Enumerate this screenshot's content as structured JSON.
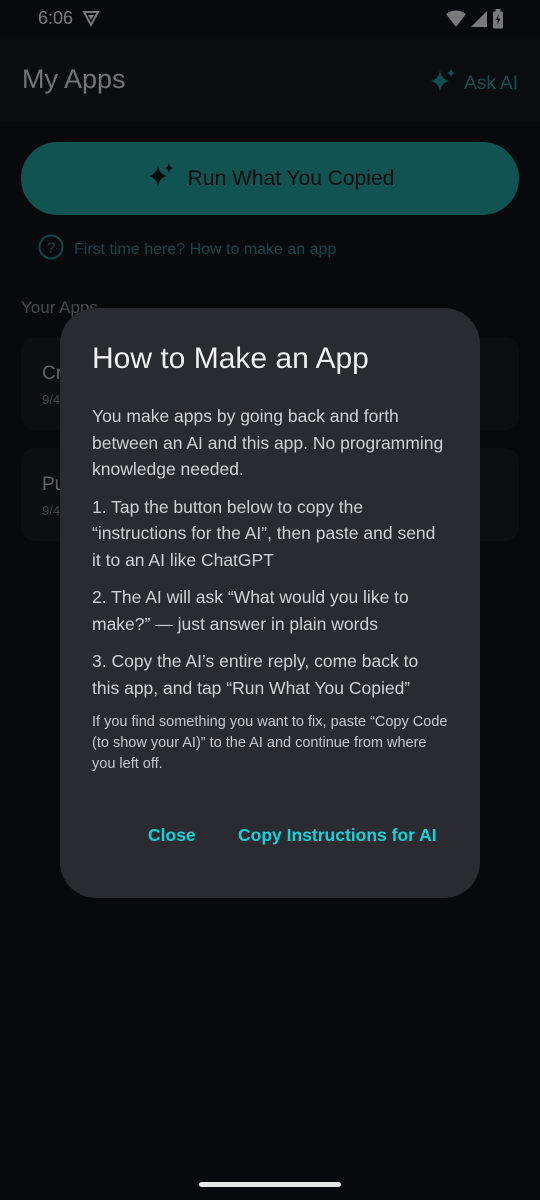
{
  "status_bar": {
    "time": "6:06",
    "icons": [
      "vpn-shield-icon",
      "wifi-icon",
      "cellular-signal-icon",
      "battery-icon"
    ]
  },
  "app_bar": {
    "title": "My Apps",
    "ask_ai_label": "Ask AI",
    "ask_ai_icon": "sparkle-icon"
  },
  "main": {
    "run_button_label": "Run What You Copied",
    "help_link_label": "First time here? How to make an app",
    "section_label": "Your Apps",
    "apps": [
      {
        "title": "Cr",
        "date": "9/4"
      },
      {
        "title": "Pu",
        "date": "9/4"
      }
    ]
  },
  "dialog": {
    "title": "How to Make an App",
    "intro": "You make apps by going back and forth between an AI and this app. No programming knowledge needed.",
    "step1": "1. Tap the button below to copy the “instructions for the AI”, then paste and send it to an AI like ChatGPT",
    "step2": "2. The AI will ask “What would you like to make?” — just answer in plain words",
    "step3": "3. Copy the AI’s entire reply, come back to this app, and tap “Run What You Copied”",
    "note": "If you find something you want to fix, paste “Copy Code (to show your AI)” to the AI and continue from where you left off.",
    "close_label": "Close",
    "copy_label": "Copy Instructions for AI"
  },
  "colors": {
    "accent": "#21a7a3",
    "dialog_action": "#19d0d8",
    "background": "#111318",
    "dialog_bg": "#2a2b30"
  }
}
